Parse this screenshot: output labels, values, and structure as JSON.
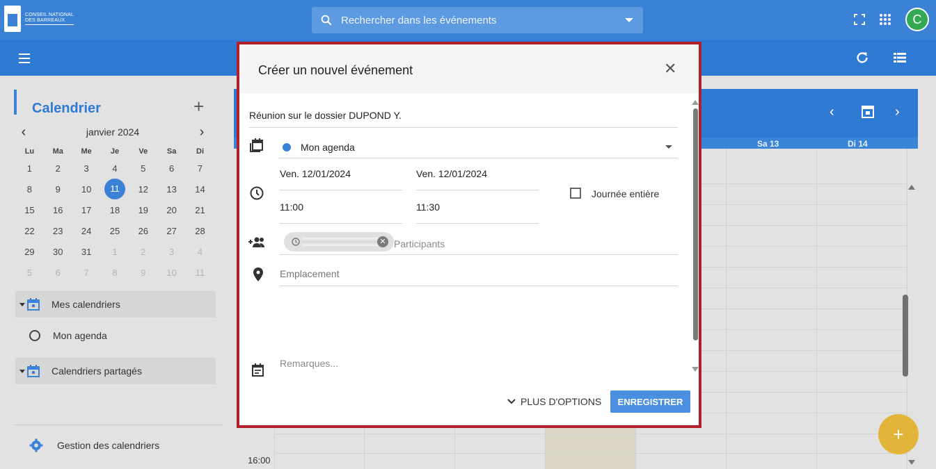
{
  "header": {
    "logo_line1": "CONSEIL NATIONAL",
    "logo_line2": "DES BARREAUX",
    "search_placeholder": "Rechercher dans les événements",
    "avatar_letter": "C"
  },
  "sidebar": {
    "title": "Calendrier",
    "add_label": "+",
    "month": "janvier 2024",
    "weekdays": [
      "Lu",
      "Ma",
      "Me",
      "Je",
      "Ve",
      "Sa",
      "Di"
    ],
    "weeks": [
      [
        "1",
        "2",
        "3",
        "4",
        "5",
        "6",
        "7"
      ],
      [
        "8",
        "9",
        "10",
        "11",
        "12",
        "13",
        "14"
      ],
      [
        "15",
        "16",
        "17",
        "18",
        "19",
        "20",
        "21"
      ],
      [
        "22",
        "23",
        "24",
        "25",
        "26",
        "27",
        "28"
      ],
      [
        "29",
        "30",
        "31",
        "1",
        "2",
        "3",
        "4"
      ],
      [
        "5",
        "6",
        "7",
        "8",
        "9",
        "10",
        "11"
      ]
    ],
    "selected_day": "11",
    "my_calendars": "Mes calendriers",
    "my_agenda": "Mon agenda",
    "shared_calendars": "Calendriers partagés",
    "manage": "Gestion des calendriers"
  },
  "calendar": {
    "day_labels": [
      "Sa 13",
      "Di 14"
    ],
    "time_label": "16:00"
  },
  "dialog": {
    "title": "Créer un nouvel événement",
    "event_title": "Réunion sur le dossier DUPOND Y.",
    "calendar": "Mon agenda",
    "calendar_color": "#3b82d6",
    "start_date": "Ven. 12/01/2024",
    "end_date": "Ven. 12/01/2024",
    "start_time": "11:00",
    "end_time": "11:30",
    "all_day": "Journée entière",
    "participants_placeholder": "Participants",
    "location_placeholder": "Emplacement",
    "notes_placeholder": "Remarques...",
    "more_options": "PLUS D'OPTIONS",
    "save": "ENREGISTRER"
  },
  "colors": {
    "primary": "#3b82d6",
    "dialog_border": "#b0202a",
    "fab": "#e2b53a",
    "avatar": "#34a853"
  }
}
